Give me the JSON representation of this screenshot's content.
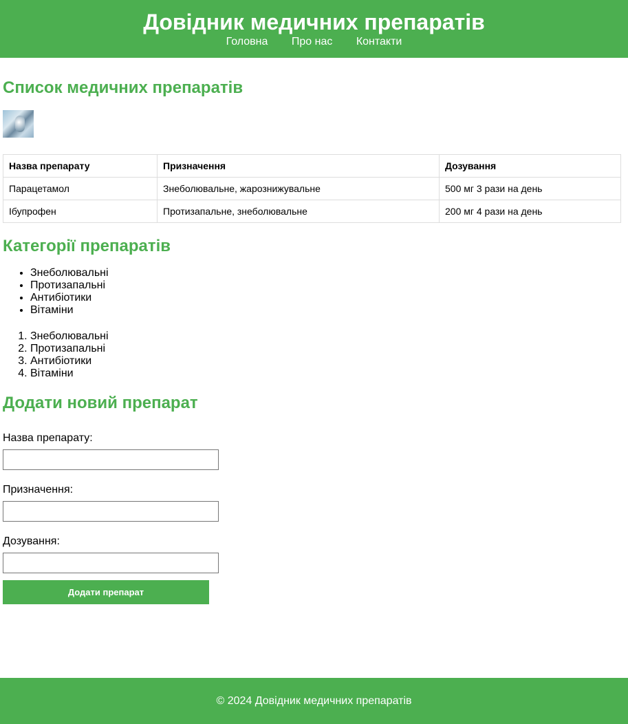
{
  "header": {
    "title": "Довідник медичних препаратів",
    "nav": [
      "Головна",
      "Про нас",
      "Контакти"
    ]
  },
  "drugs_section": {
    "title": "Список медичних препаратів",
    "table": {
      "headers": [
        "Назва препарату",
        "Призначення",
        "Дозування"
      ],
      "rows": [
        [
          "Парацетамол",
          "Знеболювальне, жарознижувальне",
          "500 мг 3 рази на день"
        ],
        [
          "Ібупрофен",
          "Протизапальне, знеболювальне",
          "200 мг 4 рази на день"
        ]
      ]
    }
  },
  "categories_section": {
    "title": "Категорії препаратів",
    "unordered": [
      "Знеболювальні",
      "Протизапальні",
      "Антибіотики",
      "Вітаміни"
    ],
    "ordered": [
      "Знеболювальні",
      "Протизапальні",
      "Антибіотики",
      "Вітаміни"
    ]
  },
  "form_section": {
    "title": "Додати новий препарат",
    "name_label": "Назва препарату:",
    "purpose_label": "Призначення:",
    "dosage_label": "Дозування:",
    "name_value": "",
    "purpose_value": "",
    "dosage_value": "",
    "submit_label": "Додати препарат"
  },
  "footer": {
    "text": "© 2024 Довідник медичних препаратів"
  },
  "colors": {
    "accent": "#4caf50",
    "header_text": "#ffffff"
  }
}
